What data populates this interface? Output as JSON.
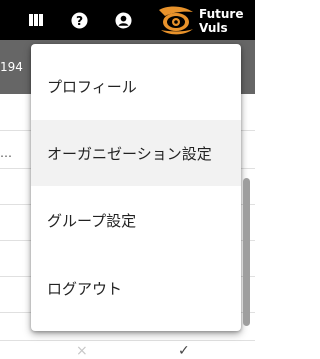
{
  "header": {
    "logo": {
      "line1": "Future",
      "line2": "Vuls"
    },
    "icons": [
      "columns-icon",
      "help-icon",
      "account-icon"
    ],
    "colors": {
      "topbar": "#000000",
      "logo_accent": "#e8922b"
    }
  },
  "subheader": {
    "count": "194"
  },
  "background": {
    "truncated_cell": "…",
    "cross_mark": "×",
    "check_mark": "✓"
  },
  "account_menu": {
    "items": [
      {
        "label": "プロフィール"
      },
      {
        "label": "オーガニゼーション設定"
      },
      {
        "label": "グループ設定"
      },
      {
        "label": "ログアウト"
      }
    ],
    "highlighted_index": 1
  }
}
